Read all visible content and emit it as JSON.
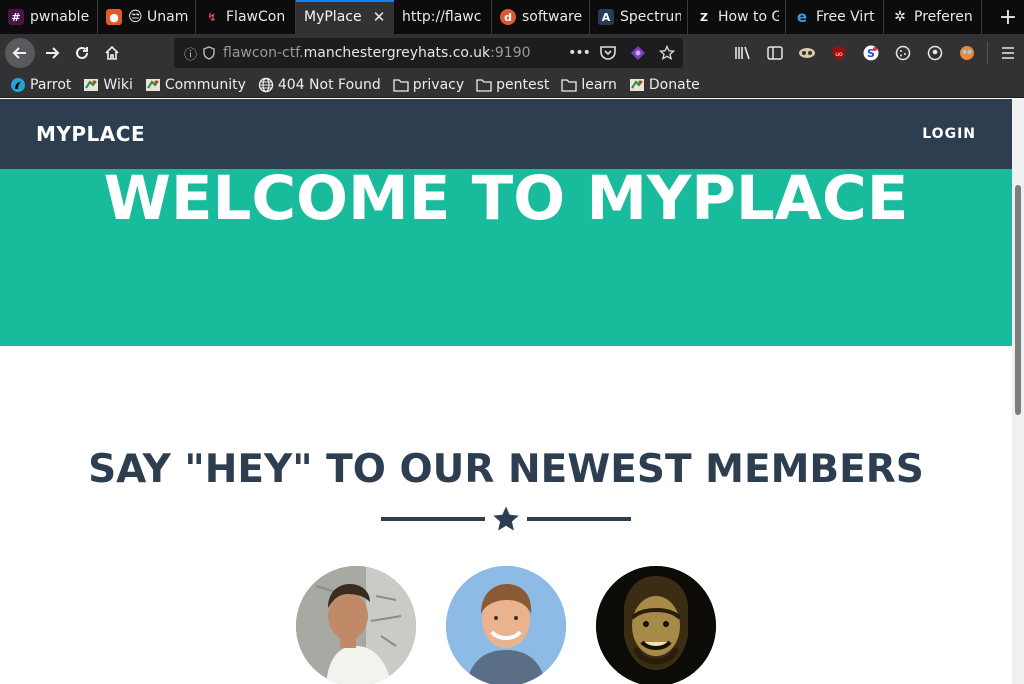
{
  "browser": {
    "tabs": [
      {
        "title": "pwnable",
        "favicon": "hash-icon",
        "active": false
      },
      {
        "title": "😒 Unam",
        "favicon": "shield-icon",
        "active": false
      },
      {
        "title": "FlawCon",
        "favicon": "flawcon-icon",
        "active": false
      },
      {
        "title": "MyPlace",
        "favicon": "",
        "active": true
      },
      {
        "title": "http://flawc",
        "favicon": "",
        "active": false
      },
      {
        "title": "software",
        "favicon": "duckduckgo-icon",
        "active": false
      },
      {
        "title": "Spectrum",
        "favicon": "a-icon",
        "active": false
      },
      {
        "title": "How to G",
        "favicon": "z-icon",
        "active": false
      },
      {
        "title": "Free Virt",
        "favicon": "edge-icon",
        "active": false
      },
      {
        "title": "Preferen",
        "favicon": "gear-icon",
        "active": false
      }
    ],
    "url_prefix": "flawcon-ctf.",
    "url_domain": "manchestergreyhats.co.uk",
    "url_suffix": ":9190",
    "bookmarks": [
      {
        "label": "Parrot",
        "icon": "parrot-icon"
      },
      {
        "label": "Wiki",
        "icon": "bookmark-icon"
      },
      {
        "label": "Community",
        "icon": "bookmark-icon"
      },
      {
        "label": "404 Not Found",
        "icon": "globe-icon"
      },
      {
        "label": "privacy",
        "icon": "folder-icon"
      },
      {
        "label": "pentest",
        "icon": "folder-icon"
      },
      {
        "label": "learn",
        "icon": "folder-icon"
      },
      {
        "label": "Donate",
        "icon": "bookmark-icon"
      }
    ]
  },
  "site": {
    "brand": "MYPLACE",
    "login": "LOGIN",
    "hero_title": "WELCOME TO MYPLACE",
    "members_title": "SAY \"HEY\" TO OUR NEWEST MEMBERS"
  },
  "colors": {
    "nav": "#2c3e50",
    "hero": "#18bc9c",
    "heading": "#2c3e50"
  }
}
